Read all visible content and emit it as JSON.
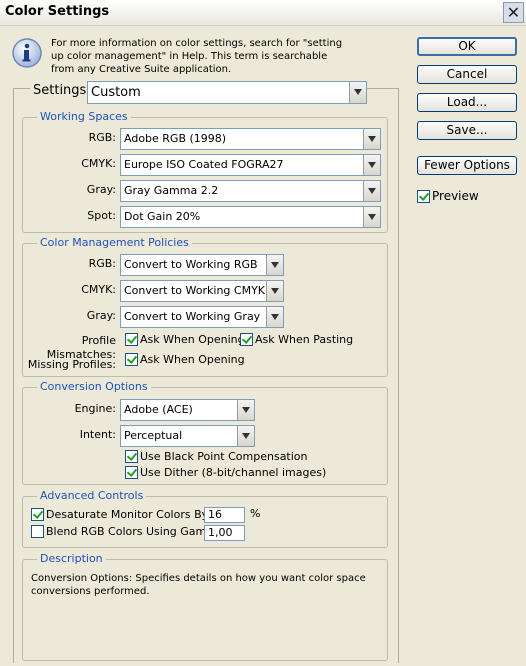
{
  "window": {
    "title": "Color Settings",
    "close_icon": "close-icon"
  },
  "info": {
    "icon": "info-icon",
    "text": "For more information on color settings, search for \"setting up color management\" in Help. This term is searchable from any Creative Suite application."
  },
  "buttons": {
    "ok": "OK",
    "reset": "Cancel",
    "load": "Load...",
    "save": "Save...",
    "fewer_options": "Fewer Options"
  },
  "preview": {
    "label": "Preview",
    "checked": true
  },
  "settings": {
    "label": "Settings:",
    "value": "Custom"
  },
  "working_spaces": {
    "title": "Working Spaces",
    "rgb_label": "RGB:",
    "rgb_value": "Adobe RGB (1998)",
    "cmyk_label": "CMYK:",
    "cmyk_value": "Europe ISO Coated FOGRA27",
    "gray_label": "Gray:",
    "gray_value": "Gray Gamma 2.2",
    "spot_label": "Spot:",
    "spot_value": "Dot Gain 20%"
  },
  "policies": {
    "title": "Color Management Policies",
    "rgb_label": "RGB:",
    "rgb_value": "Convert to Working RGB",
    "cmyk_label": "CMYK:",
    "cmyk_value": "Convert to Working CMYK",
    "gray_label": "Gray:",
    "gray_value": "Convert to Working Gray",
    "mismatch_label": "Profile Mismatches:",
    "ask_opening": "Ask When Opening",
    "ask_pasting": "Ask When Pasting",
    "missing_label": "Missing Profiles:",
    "missing_ask_opening": "Ask When Opening"
  },
  "conversion": {
    "title": "Conversion Options",
    "engine_label": "Engine:",
    "engine_value": "Adobe (ACE)",
    "intent_label": "Intent:",
    "intent_value": "Perceptual",
    "black_point": "Use Black Point Compensation",
    "dither": "Use Dither (8-bit/channel images)"
  },
  "advanced": {
    "title": "Advanced Controls",
    "desaturate_label": "Desaturate Monitor Colors By:",
    "desaturate_value": "16",
    "desaturate_unit": "%",
    "blend_label": "Blend RGB Colors Using Gamma:",
    "blend_value": "1,00"
  },
  "description": {
    "title": "Description",
    "text": "Conversion Options:  Specifies details on how you want color space conversions performed."
  },
  "colors": {
    "legend": "#1f52b8",
    "background": "#ece9d8",
    "check": "#21a121"
  }
}
